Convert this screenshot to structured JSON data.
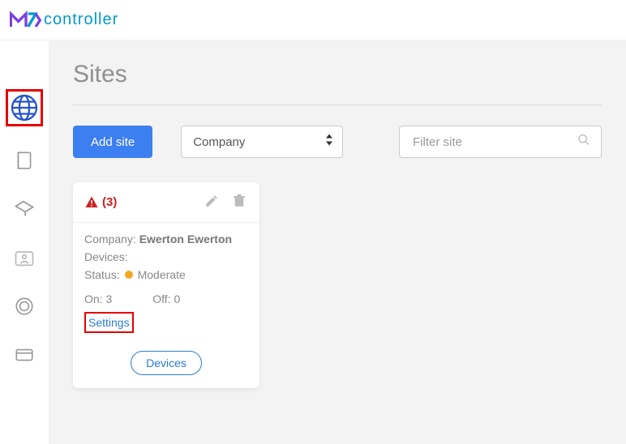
{
  "brand": {
    "name": "controller"
  },
  "page": {
    "title": "Sites"
  },
  "toolbar": {
    "add_site_label": "Add site",
    "group_by_selected": "Company",
    "filter_placeholder": "Filter site"
  },
  "cards": [
    {
      "alert_count_text": "(3)",
      "labels": {
        "company": "Company:",
        "devices": "Devices:",
        "status": "Status:",
        "on": "On:",
        "off": "Off:"
      },
      "company": "Ewerton Ewerton",
      "devices": "",
      "status_text": "Moderate",
      "status_color": "#f5a623",
      "on": "3",
      "off": "0",
      "settings_label": "Settings",
      "devices_button_label": "Devices"
    }
  ]
}
